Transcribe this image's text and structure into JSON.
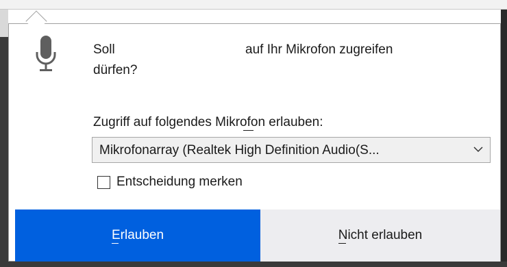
{
  "prompt": {
    "soll": "Soll",
    "rest": "auf Ihr Mikrofon zugreifen",
    "line2": "dürfen?"
  },
  "device": {
    "label": "Zugriff auf folgendes Mikrofon erlauben:",
    "selected": "Mikrofonarray (Realtek High Definition Audio(S..."
  },
  "remember": {
    "label": "Entscheidung merken",
    "checked": false
  },
  "buttons": {
    "allow": "Erlauben",
    "deny": "Nicht erlauben"
  },
  "colors": {
    "primary": "#0060df",
    "secondary_bg": "#ededf0"
  },
  "icons": {
    "microphone": "microphone-icon",
    "chevron": "chevron-down-icon"
  }
}
